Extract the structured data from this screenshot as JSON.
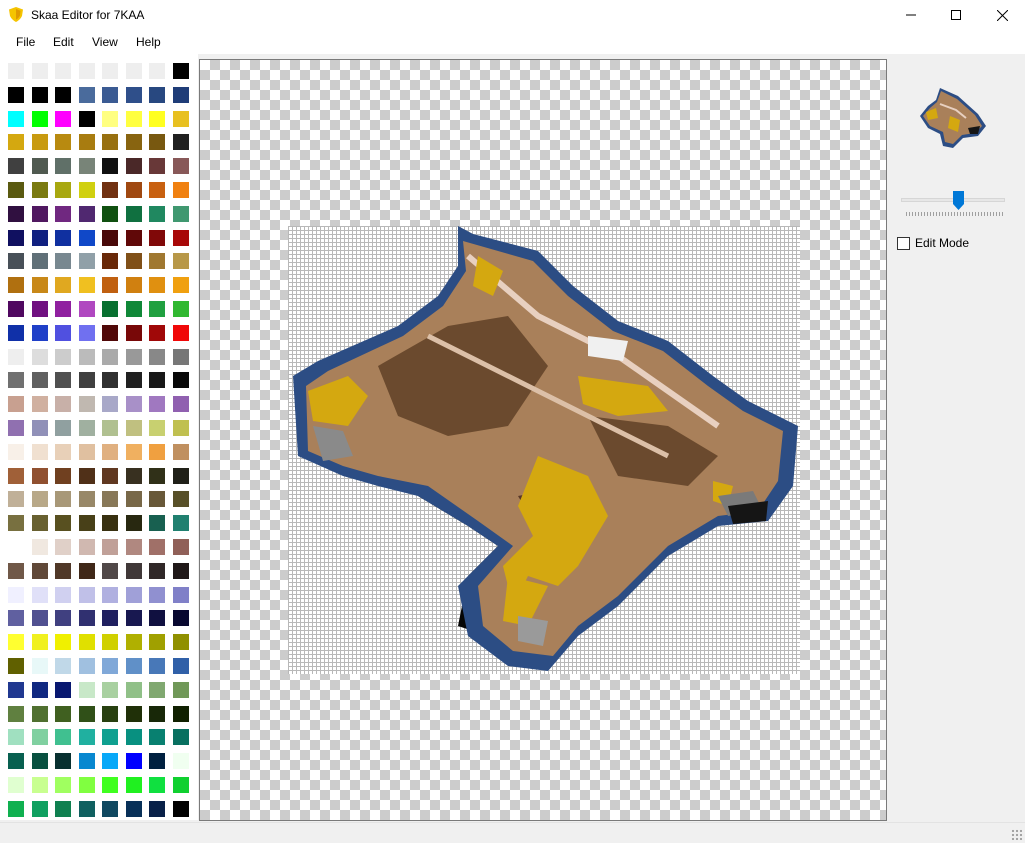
{
  "window": {
    "title": "Skaa Editor for 7KAA",
    "controls": [
      "minimize",
      "maximize",
      "close"
    ]
  },
  "menu": {
    "items": [
      "File",
      "Edit",
      "View",
      "Help"
    ]
  },
  "palette": {
    "columns": 8,
    "colors": [
      "#eeeeee",
      "#eeeeee",
      "#eeeeee",
      "#eeeeee",
      "#eeeeee",
      "#eeeeee",
      "#eeeeee",
      "#000000",
      "#000000",
      "#000000",
      "#000000",
      "#4a6b9c",
      "#3b5b93",
      "#2f4f8a",
      "#284880",
      "#1f3d78",
      "#00ffff",
      "#00ff00",
      "#ff00ff",
      "#000000",
      "#ffff80",
      "#ffff40",
      "#ffff20",
      "#e8c020",
      "#d4a810",
      "#c89a10",
      "#b88a10",
      "#a87c10",
      "#987010",
      "#886410",
      "#785810",
      "#202020",
      "#404040",
      "#505a50",
      "#607068",
      "#788478",
      "#101010",
      "#4a2828",
      "#683838",
      "#885858",
      "#5a5a10",
      "#7a7a10",
      "#a8a810",
      "#d0d010",
      "#703010",
      "#a04810",
      "#c86010",
      "#f08010",
      "#301040",
      "#501860",
      "#702880",
      "#502870",
      "#105010",
      "#107040",
      "#208860",
      "#409870",
      "#101060",
      "#102080",
      "#1030a0",
      "#1048c8",
      "#480808",
      "#600808",
      "#800808",
      "#a80808",
      "#485058",
      "#607078",
      "#788890",
      "#90a0a8",
      "#682808",
      "#805018",
      "#a07830",
      "#b89848",
      "#b07010",
      "#c88818",
      "#e0a820",
      "#f0c020",
      "#c06010",
      "#d08010",
      "#e09010",
      "#f0a010",
      "#500860",
      "#701080",
      "#9020a0",
      "#b048c0",
      "#087030",
      "#108838",
      "#20a040",
      "#30b830",
      "#1030a8",
      "#2040c8",
      "#5050e0",
      "#7070f0",
      "#500808",
      "#780808",
      "#a00808",
      "#f00808",
      "#eeeeee",
      "#dddddd",
      "#cccccc",
      "#bbbbbb",
      "#aaaaaa",
      "#999999",
      "#888888",
      "#777777",
      "#707070",
      "#606060",
      "#505050",
      "#404040",
      "#303030",
      "#202020",
      "#181818",
      "#080808",
      "#c8a090",
      "#d0b0a0",
      "#c8b0a8",
      "#c0b8b0",
      "#a8a8c8",
      "#a890c8",
      "#a078c0",
      "#9060b0",
      "#9070b0",
      "#9090b8",
      "#90a0a0",
      "#a0b0a0",
      "#b0c090",
      "#c0c080",
      "#c8d070",
      "#c0c050",
      "#f8f0e8",
      "#f0e0d0",
      "#e8d0b8",
      "#e0c0a0",
      "#e0b080",
      "#f0b060",
      "#f0a040",
      "#c09060",
      "#a06038",
      "#905030",
      "#704020",
      "#503018",
      "#603820",
      "#383020",
      "#303018",
      "#202018",
      "#c0b098",
      "#b8a888",
      "#a89878",
      "#988868",
      "#887858",
      "#786848",
      "#685838",
      "#585028",
      "#787040",
      "#686030",
      "#585020",
      "#484018",
      "#383010",
      "#282810",
      "#186050",
      "#208070",
      "#ffffff",
      "#f0e8e0",
      "#e0d0c8",
      "#d0b8b0",
      "#c0a098",
      "#b08880",
      "#a07068",
      "#906058",
      "#705848",
      "#604838",
      "#503828",
      "#402818",
      "#504848",
      "#403838",
      "#302828",
      "#201818",
      "#f0f0ff",
      "#e0e0f8",
      "#d0d0f0",
      "#c0c0e8",
      "#b0b0e0",
      "#a0a0d8",
      "#9090d0",
      "#8080c8",
      "#6060a0",
      "#505090",
      "#404080",
      "#303070",
      "#202060",
      "#181850",
      "#101040",
      "#080830",
      "#ffff30",
      "#f0f020",
      "#f0f000",
      "#e0e000",
      "#d0d000",
      "#b0b000",
      "#a0a000",
      "#909000",
      "#606000",
      "#e8f8f8",
      "#c0d8e8",
      "#a0c0e0",
      "#80a8d8",
      "#6090c8",
      "#4878b8",
      "#3060a8",
      "#203890",
      "#102880",
      "#081870",
      "#c8e8c8",
      "#a8d0a0",
      "#90c088",
      "#80a870",
      "#709858",
      "#608040",
      "#507030",
      "#406020",
      "#305018",
      "#284010",
      "#203008",
      "#182808",
      "#102000",
      "#a0e0c0",
      "#80d0a0",
      "#40c090",
      "#20b0a0",
      "#10a090",
      "#089080",
      "#088070",
      "#087060",
      "#086050",
      "#085040",
      "#083030",
      "#0888d0",
      "#08a8f8",
      "#0000ff",
      "#002040",
      "#f0fff0",
      "#e0ffd0",
      "#c8ff90",
      "#a0ff60",
      "#80ff40",
      "#40ff20",
      "#20f020",
      "#10e040",
      "#10d030",
      "#10b050",
      "#10a060",
      "#108050",
      "#106060",
      "#104860",
      "#083058",
      "#082048",
      "#000000"
    ]
  },
  "tool_panel": {
    "zoom_level_fraction": 0.5,
    "edit_mode_label": "Edit Mode",
    "edit_mode_checked": false
  }
}
